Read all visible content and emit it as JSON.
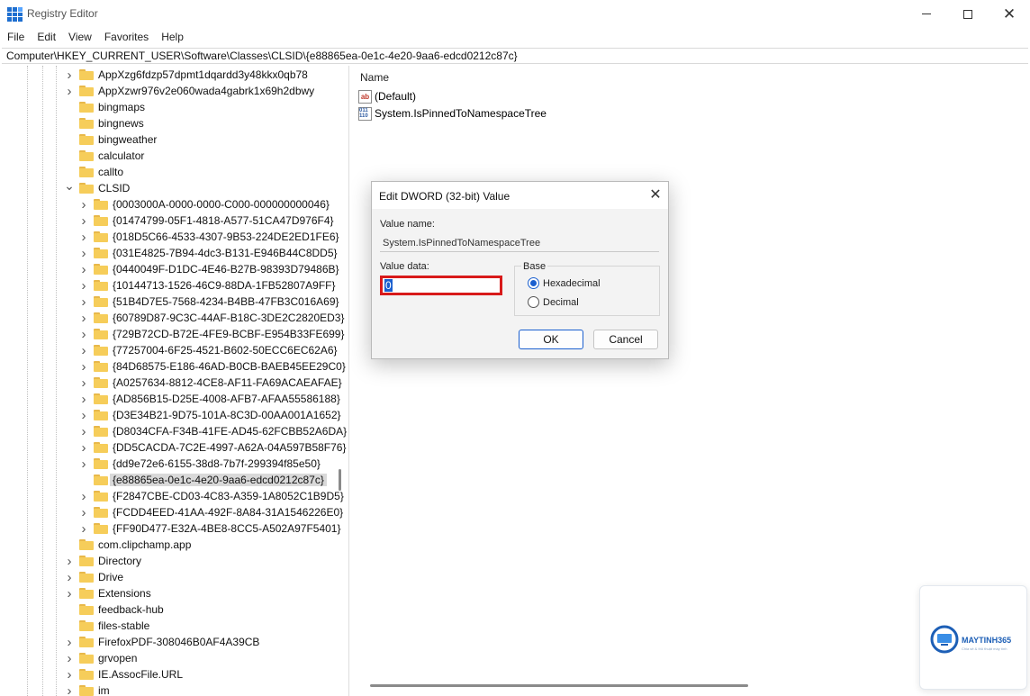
{
  "window": {
    "title": "Registry Editor",
    "controls": {
      "minimize": "minimize",
      "maximize": "maximize",
      "close": "✕"
    }
  },
  "menu": [
    "File",
    "Edit",
    "View",
    "Favorites",
    "Help"
  ],
  "address": "Computer\\HKEY_CURRENT_USER\\Software\\Classes\\CLSID\\{e88865ea-0e1c-4e20-9aa6-edcd0212c87c}",
  "tree": {
    "items": [
      {
        "label": "AppXzg6fdzp57dpmt1dqardd3y48kkx0qb78",
        "level": 1,
        "chevron": "right"
      },
      {
        "label": "AppXzwr976v2e060wada4gabrk1x69h2dbwy",
        "level": 1,
        "chevron": "right"
      },
      {
        "label": "bingmaps",
        "level": 1,
        "chevron": "none"
      },
      {
        "label": "bingnews",
        "level": 1,
        "chevron": "none"
      },
      {
        "label": "bingweather",
        "level": 1,
        "chevron": "none"
      },
      {
        "label": "calculator",
        "level": 1,
        "chevron": "none"
      },
      {
        "label": "callto",
        "level": 1,
        "chevron": "none"
      },
      {
        "label": "CLSID",
        "level": 1,
        "chevron": "down"
      },
      {
        "label": "{0003000A-0000-0000-C000-000000000046}",
        "level": 2,
        "chevron": "right"
      },
      {
        "label": "{01474799-05F1-4818-A577-51CA47D976F4}",
        "level": 2,
        "chevron": "right"
      },
      {
        "label": "{018D5C66-4533-4307-9B53-224DE2ED1FE6}",
        "level": 2,
        "chevron": "right"
      },
      {
        "label": "{031E4825-7B94-4dc3-B131-E946B44C8DD5}",
        "level": 2,
        "chevron": "right"
      },
      {
        "label": "{0440049F-D1DC-4E46-B27B-98393D79486B}",
        "level": 2,
        "chevron": "right"
      },
      {
        "label": "{10144713-1526-46C9-88DA-1FB52807A9FF}",
        "level": 2,
        "chevron": "right"
      },
      {
        "label": "{51B4D7E5-7568-4234-B4BB-47FB3C016A69}",
        "level": 2,
        "chevron": "right"
      },
      {
        "label": "{60789D87-9C3C-44AF-B18C-3DE2C2820ED3}",
        "level": 2,
        "chevron": "right"
      },
      {
        "label": "{729B72CD-B72E-4FE9-BCBF-E954B33FE699}",
        "level": 2,
        "chevron": "right"
      },
      {
        "label": "{77257004-6F25-4521-B602-50ECC6EC62A6}",
        "level": 2,
        "chevron": "right"
      },
      {
        "label": "{84D68575-E186-46AD-B0CB-BAEB45EE29C0}",
        "level": 2,
        "chevron": "right"
      },
      {
        "label": "{A0257634-8812-4CE8-AF11-FA69ACAEAFAE}",
        "level": 2,
        "chevron": "right"
      },
      {
        "label": "{AD856B15-D25E-4008-AFB7-AFAA55586188}",
        "level": 2,
        "chevron": "right"
      },
      {
        "label": "{D3E34B21-9D75-101A-8C3D-00AA001A1652}",
        "level": 2,
        "chevron": "right"
      },
      {
        "label": "{D8034CFA-F34B-41FE-AD45-62FCBB52A6DA}",
        "level": 2,
        "chevron": "right"
      },
      {
        "label": "{DD5CACDA-7C2E-4997-A62A-04A597B58F76}",
        "level": 2,
        "chevron": "right"
      },
      {
        "label": "{dd9e72e6-6155-38d8-7b7f-299394f85e50}",
        "level": 2,
        "chevron": "right"
      },
      {
        "label": "{e88865ea-0e1c-4e20-9aa6-edcd0212c87c}",
        "level": 2,
        "chevron": "none",
        "selected": true
      },
      {
        "label": "{F2847CBE-CD03-4C83-A359-1A8052C1B9D5}",
        "level": 2,
        "chevron": "right"
      },
      {
        "label": "{FCDD4EED-41AA-492F-8A84-31A1546226E0}",
        "level": 2,
        "chevron": "right"
      },
      {
        "label": "{FF90D477-E32A-4BE8-8CC5-A502A97F5401}",
        "level": 2,
        "chevron": "right"
      },
      {
        "label": "com.clipchamp.app",
        "level": 1,
        "chevron": "none"
      },
      {
        "label": "Directory",
        "level": 1,
        "chevron": "right"
      },
      {
        "label": "Drive",
        "level": 1,
        "chevron": "right"
      },
      {
        "label": "Extensions",
        "level": 1,
        "chevron": "right"
      },
      {
        "label": "feedback-hub",
        "level": 1,
        "chevron": "none"
      },
      {
        "label": "files-stable",
        "level": 1,
        "chevron": "none"
      },
      {
        "label": "FirefoxPDF-308046B0AF4A39CB",
        "level": 1,
        "chevron": "right"
      },
      {
        "label": "grvopen",
        "level": 1,
        "chevron": "right"
      },
      {
        "label": "IE.AssocFile.URL",
        "level": 1,
        "chevron": "right"
      },
      {
        "label": "im",
        "level": 1,
        "chevron": "right"
      }
    ]
  },
  "values": {
    "column_name": "Name",
    "rows": [
      {
        "name": "(Default)",
        "icon": "string-value-icon",
        "glyph": "ab"
      },
      {
        "name": "System.IsPinnedToNamespaceTree",
        "icon": "dword-value-icon",
        "glyph": "011 110"
      }
    ]
  },
  "dialog": {
    "title": "Edit DWORD (32-bit) Value",
    "close": "✕",
    "value_name_label": "Value name:",
    "value_name": "System.IsPinnedToNamespaceTree",
    "value_data_label": "Value data:",
    "value_data": "0",
    "base_label": "Base",
    "base_options": [
      {
        "label": "Hexadecimal",
        "checked": true
      },
      {
        "label": "Decimal",
        "checked": false
      }
    ],
    "ok_label": "OK",
    "cancel_label": "Cancel",
    "highlight_color": "#d81a1a"
  },
  "watermark": {
    "brand": "MAYTINH365",
    "tagline": "Chia sẻ & thủ thuật máy tính"
  },
  "colors": {
    "accent": "#1a5fcf",
    "folder": "#f6cd5a",
    "selection": "#d9d9d9"
  }
}
